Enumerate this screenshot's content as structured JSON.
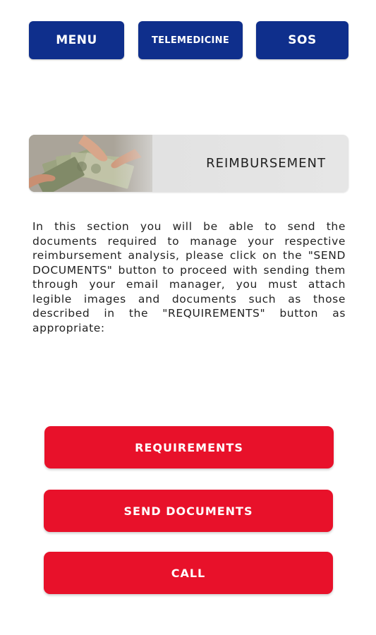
{
  "topnav": {
    "menu_label": "MENU",
    "telemedicine_label": "TELEMEDICINE",
    "sos_label": "SOS"
  },
  "banner": {
    "title": "REIMBURSEMENT",
    "image_icon": "money-in-hands-icon"
  },
  "description": "In this section you will be able to send the documents required to manage your respective reimbursement analysis, please click on the \"SEND DOCUMENTS\" button to proceed with sending them through your email manager, you must attach legible images and documents such as those described in the \"REQUIREMENTS\" button as appropriate:",
  "actions": {
    "requirements_label": "REQUIREMENTS",
    "send_documents_label": "SEND DOCUMENTS",
    "call_label": "CALL"
  },
  "colors": {
    "nav_blue": "#0f2f8c",
    "action_red": "#e8112a",
    "banner_gray": "#e2e2e2"
  }
}
